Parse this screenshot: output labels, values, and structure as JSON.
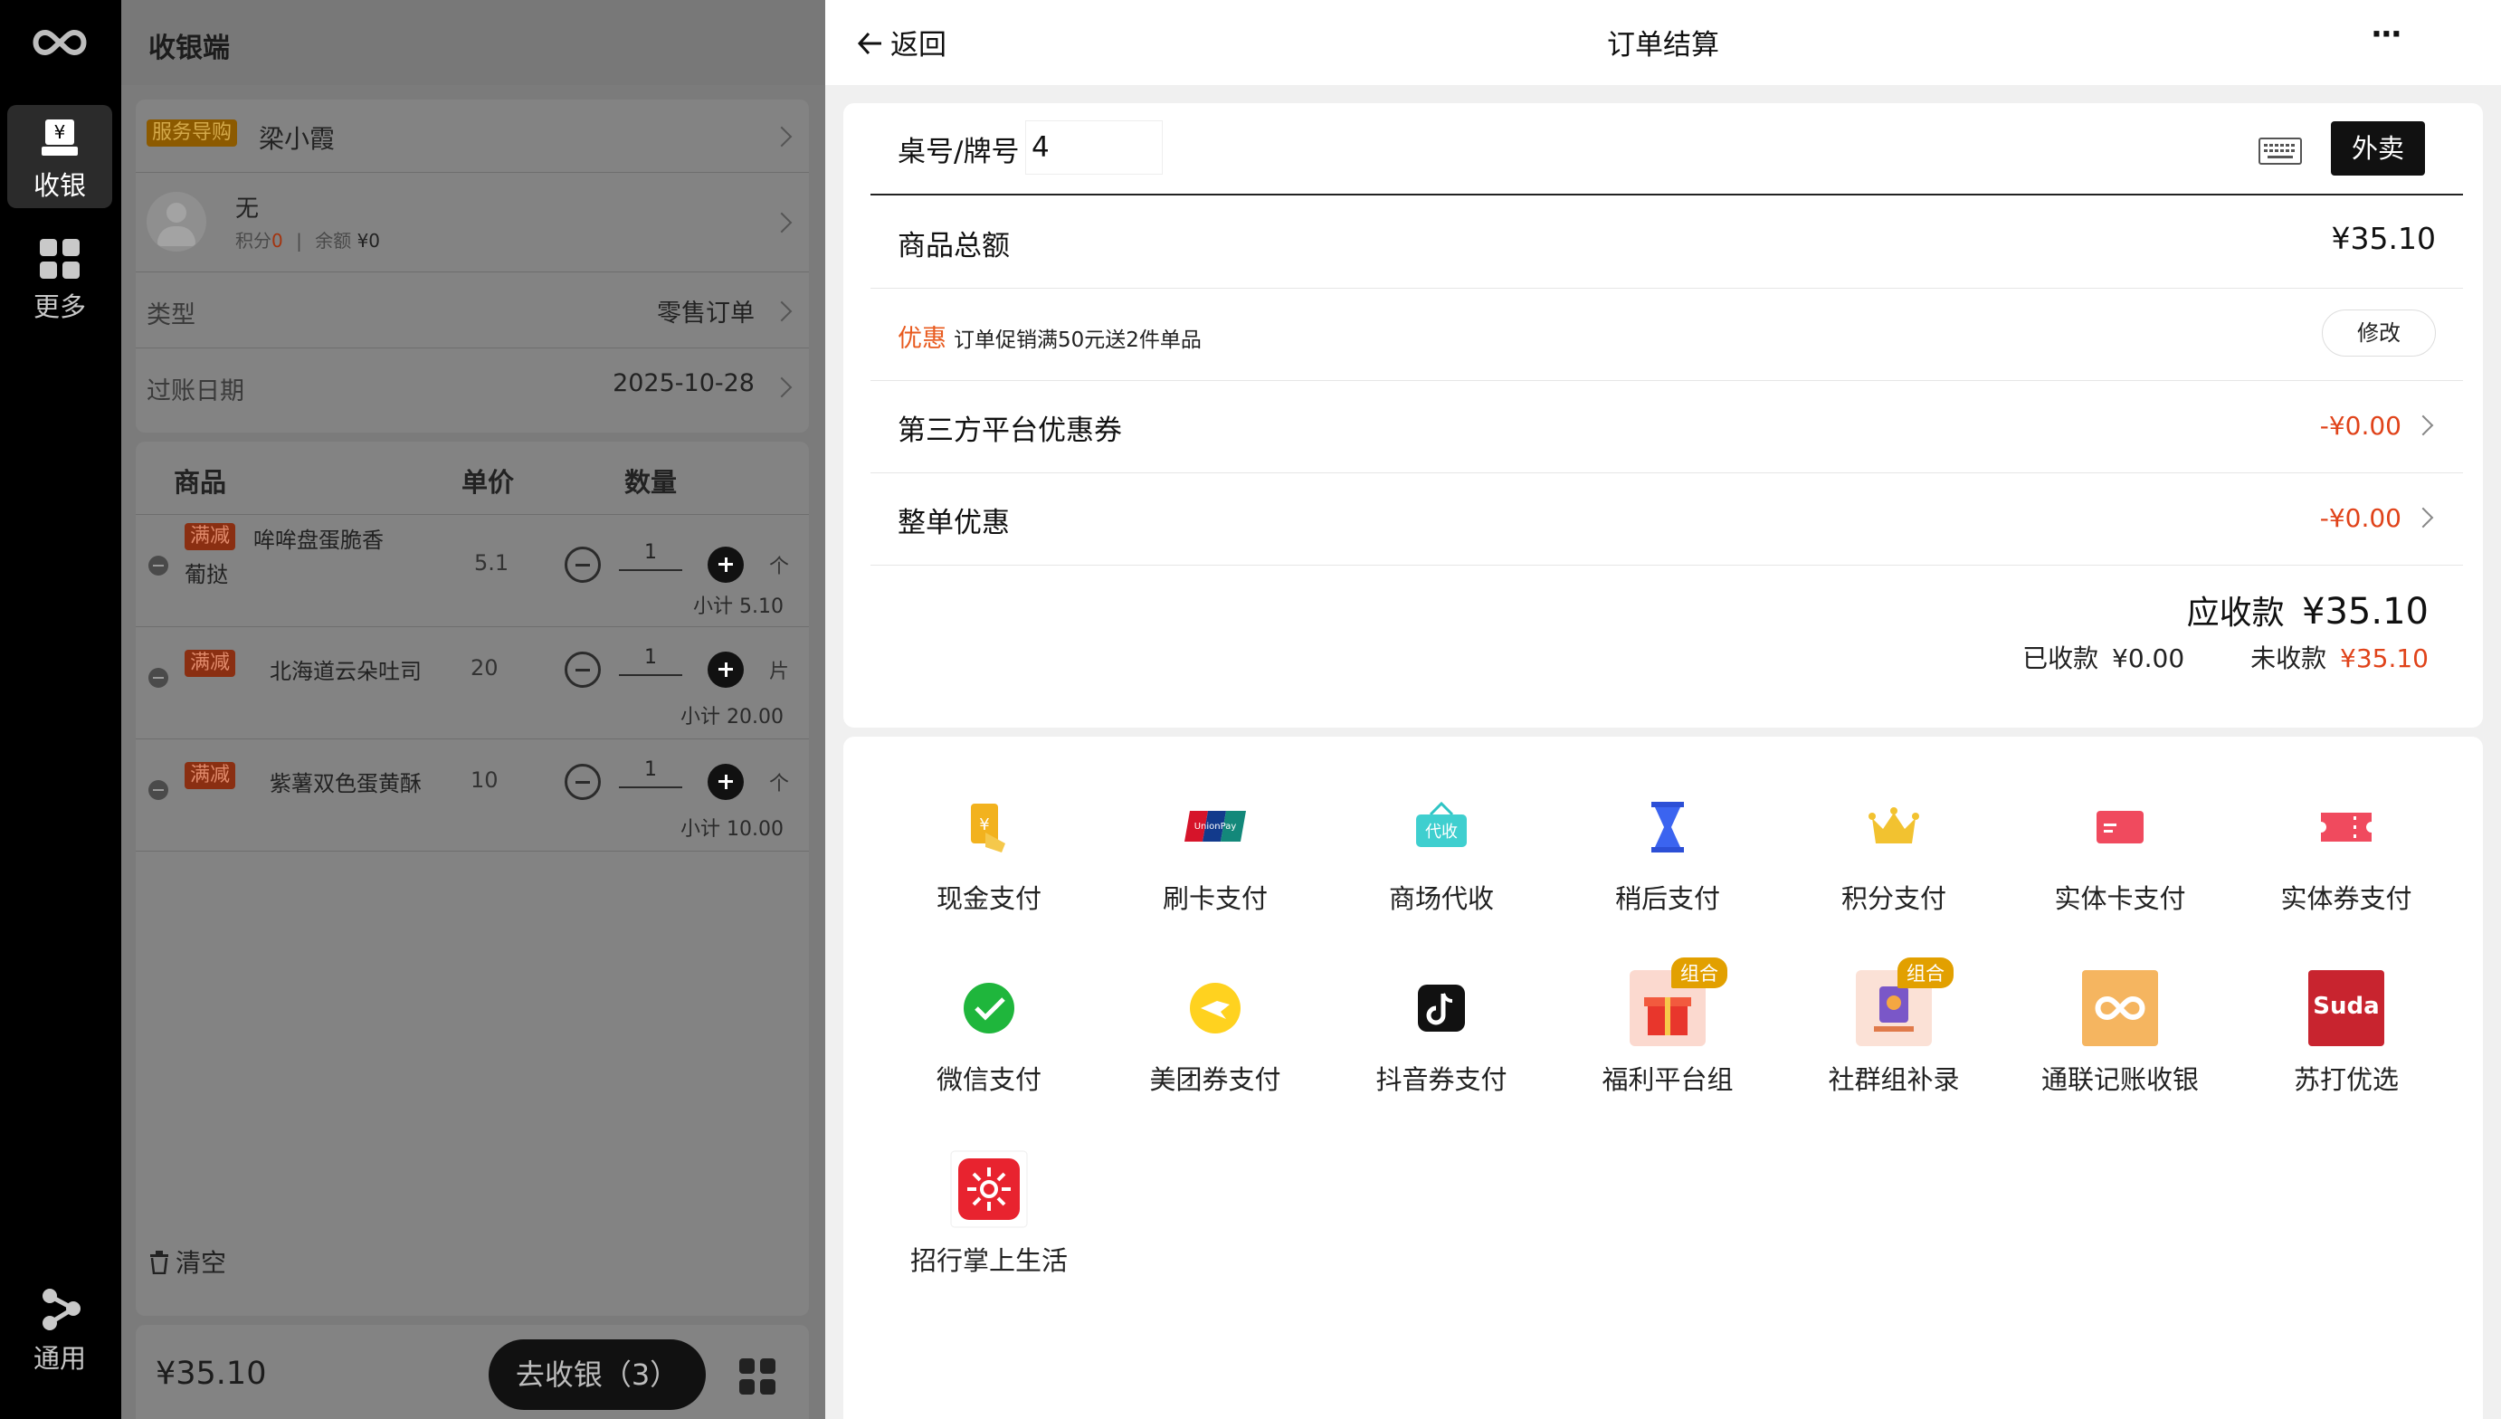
{
  "rail": {
    "items": [
      {
        "label": "收银",
        "icon": "cashier-icon",
        "active": true
      },
      {
        "label": "更多",
        "icon": "grid-icon",
        "active": false
      },
      {
        "label": "通用",
        "icon": "share-icon",
        "active": false
      }
    ]
  },
  "left": {
    "title": "收银端",
    "guide_tag": "服务导购",
    "guide_name": "梁小霞",
    "member_name": "无",
    "member_points_label": "积分",
    "member_points": "0",
    "member_balance_label": "余额",
    "member_balance": "¥0",
    "type_label": "类型",
    "type_value": "零售订单",
    "date_label": "过账日期",
    "date_value": "2025-10-28",
    "col_product": "商品",
    "col_price": "单价",
    "col_qty": "数量",
    "items": [
      {
        "tag": "满减",
        "name": "哞哞盘蛋脆香葡挞",
        "price": "5.1",
        "qty": "1",
        "unit": "个",
        "subtotal": "小计 5.10"
      },
      {
        "tag": "满减",
        "name": "北海道云朵吐司",
        "price": "20",
        "qty": "1",
        "unit": "片",
        "subtotal": "小计 20.00"
      },
      {
        "tag": "满减",
        "name": "紫薯双色蛋黄酥",
        "price": "10",
        "qty": "1",
        "unit": "个",
        "subtotal": "小计 10.00"
      }
    ],
    "clear_label": "清空",
    "total": "¥35.10",
    "checkout_label": "去收银（3）"
  },
  "right": {
    "back_label": "返回",
    "title": "订单结算",
    "more_label": "···",
    "table_label": "桌号/牌号",
    "table_value": "4",
    "takeout_label": "外卖",
    "goods_total_label": "商品总额",
    "goods_total_value": "¥35.10",
    "promo_tag": "优惠",
    "promo_text": "订单促销满50元送2件单品",
    "modify_label": "修改",
    "coupon_label": "第三方平台优惠券",
    "coupon_value": "-¥0.00",
    "discount_label": "整单优惠",
    "discount_value": "-¥0.00",
    "receivable_label": "应收款",
    "receivable_value": "¥35.10",
    "received_label": "已收款",
    "received_value": "¥0.00",
    "unpaid_label": "未收款",
    "unpaid_value": "¥35.10"
  },
  "payments": [
    {
      "label": "现金支付",
      "icon": "cash-icon"
    },
    {
      "label": "刷卡支付",
      "icon": "unionpay-icon"
    },
    {
      "label": "商场代收",
      "icon": "mall-collect-icon",
      "icon_text": "代收"
    },
    {
      "label": "稍后支付",
      "icon": "hourglass-icon"
    },
    {
      "label": "积分支付",
      "icon": "crown-icon"
    },
    {
      "label": "实体卡支付",
      "icon": "card-icon"
    },
    {
      "label": "实体券支付",
      "icon": "ticket-icon"
    },
    {
      "label": "微信支付",
      "icon": "wechat-icon"
    },
    {
      "label": "美团券支付",
      "icon": "meituan-icon"
    },
    {
      "label": "抖音券支付",
      "icon": "douyin-icon"
    },
    {
      "label": "福利平台组",
      "icon": "gift-icon",
      "badge": "组合"
    },
    {
      "label": "社群组补录",
      "icon": "community-icon",
      "badge": "组合"
    },
    {
      "label": "通联记账收银",
      "icon": "allinpay-icon"
    },
    {
      "label": "苏打优选",
      "icon": "suda-icon",
      "icon_text": "Suda"
    },
    {
      "label": "招行掌上生活",
      "icon": "cmb-icon"
    }
  ],
  "colors": {
    "accent_red": "#e0431a",
    "promo_orange": "#e85a1e",
    "dark": "#111111"
  }
}
